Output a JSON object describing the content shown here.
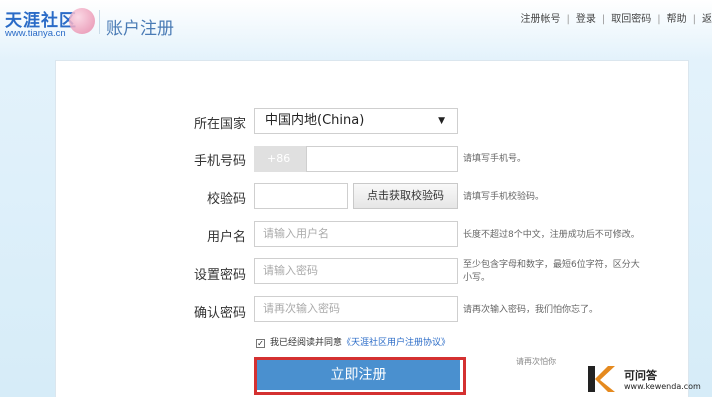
{
  "header": {
    "logo_text": "天涯社区",
    "logo_url": "www.tianya.cn",
    "page_title": "账户注册",
    "nav": [
      "注册帐号",
      "登录",
      "取回密码",
      "帮助",
      "返"
    ]
  },
  "form": {
    "country": {
      "label": "所在国家",
      "value": "中国内地(China)",
      "arrow": "▼"
    },
    "phone": {
      "label": "手机号码",
      "prefix": "+86",
      "hint": "请填写手机号。"
    },
    "code": {
      "label": "校验码",
      "button": "点击获取校验码",
      "hint": "请填写手机校验码。"
    },
    "username": {
      "label": "用户名",
      "placeholder": "请输入用户名",
      "hint": "长度不超过8个中文，注册成功后不可修改。"
    },
    "password": {
      "label": "设置密码",
      "placeholder": "请输入密码",
      "hint_line1": "至少包含字母和数字，最短6位字符，区分大",
      "hint_line2": "小写。"
    },
    "confirm": {
      "label": "确认密码",
      "placeholder": "请再次输入密码",
      "hint": "请再次输入密码，我们怕你忘了。"
    },
    "agree_text": "我已经阅读并同意",
    "agree_link": "《天涯社区用户注册协议》",
    "submit": "立即注册",
    "faint_text": "请再次怕你"
  },
  "watermark": {
    "title": "可问答",
    "url": "www.kewenda.com"
  },
  "colors": {
    "accent": "#4a90cf",
    "highlight": "#d43131",
    "logo": "#2a6bc7"
  }
}
